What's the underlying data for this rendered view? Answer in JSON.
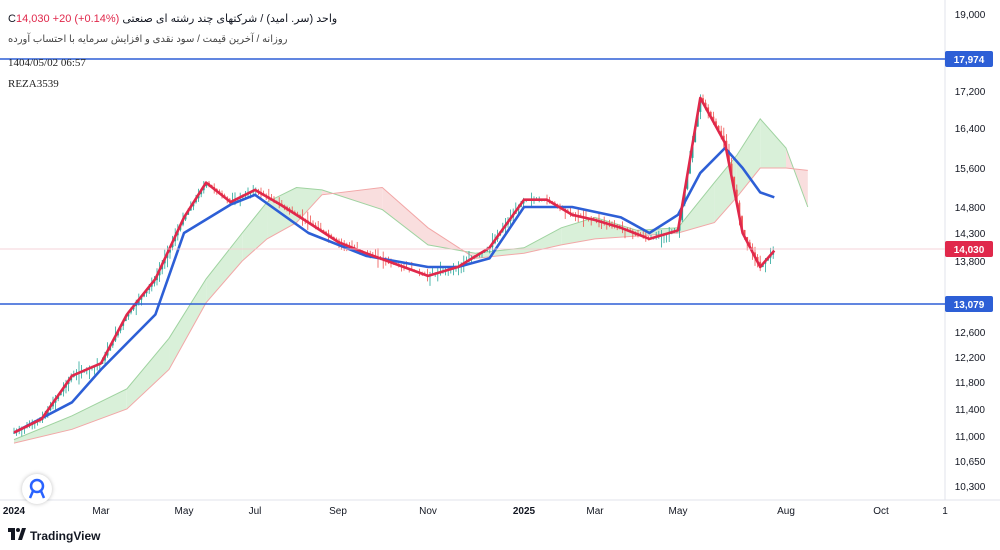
{
  "header": {
    "title": "واحد (سر. امید) / شرکتهای چند رشته ای صنعتی",
    "ohlc_prefix": "C",
    "close_label": "14,030",
    "change_label": "+20 (+0.14%)",
    "subtitle": "روزانه / آخرین قیمت / سود نقدی و افزایش سرمایه با احتساب آورده",
    "date": "1404/05/02 06:57",
    "user": "REZA3539"
  },
  "colors": {
    "price_line": "#e0284b",
    "baseline": "#2d5fd6",
    "kijun_h": "#3a66e0",
    "cloud_bull": "#d9f0d9",
    "cloud_bear": "#f9dede",
    "candle_up": "#26a69a",
    "candle_down": "#ef5350",
    "hline": "#2d5fd6",
    "price_label_bg": "#e0284b"
  },
  "icons": {
    "logo": "tradingview-logo-icon",
    "badge": "ideas-icon"
  },
  "brand": "TradingView",
  "chart_data": {
    "type": "line",
    "y_ticks": [
      "19,000",
      "17,200",
      "16,400",
      "15,600",
      "14,800",
      "14,300",
      "13,800",
      "12,600",
      "12,200",
      "11,800",
      "11,400",
      "11,000",
      "10,650",
      "10,300"
    ],
    "x_ticks": [
      "2024",
      "Mar",
      "May",
      "Jul",
      "Sep",
      "Nov",
      "2025",
      "Mar",
      "May",
      "Aug",
      "Oct",
      "1"
    ],
    "horizontal_lines": [
      {
        "label": "17,974",
        "value": 17974
      },
      {
        "label": "13,079",
        "value": 13079
      }
    ],
    "last_price_label": "14,030",
    "last_price": 14030,
    "ylim": [
      10300,
      19000
    ],
    "series": [
      {
        "role": "close",
        "x": [
          "2024-01-01",
          "2024-01-20",
          "2024-02-10",
          "2024-03-01",
          "2024-03-20",
          "2024-04-10",
          "2024-05-01",
          "2024-05-20",
          "2024-06-10",
          "2024-07-01",
          "2024-07-20",
          "2024-08-10",
          "2024-09-01",
          "2024-09-20",
          "2024-10-10",
          "2024-11-01",
          "2024-11-20",
          "2024-12-10",
          "2025-01-01",
          "2025-01-20",
          "2025-02-10",
          "2025-03-01",
          "2025-03-20",
          "2025-04-10",
          "2025-05-01",
          "2025-05-20",
          "2025-06-10",
          "2025-06-25",
          "2025-07-10",
          "2025-07-22"
        ],
        "y": [
          11050,
          11250,
          11900,
          12100,
          12900,
          13500,
          14600,
          15300,
          14900,
          15150,
          14850,
          14500,
          14150,
          13950,
          13750,
          13550,
          13700,
          14050,
          14950,
          14950,
          14650,
          14550,
          14400,
          14200,
          14350,
          17050,
          16100,
          14300,
          13700,
          14000
        ]
      },
      {
        "role": "baseline",
        "x": [
          "2024-01-01",
          "2024-02-10",
          "2024-03-01",
          "2024-04-10",
          "2024-05-01",
          "2024-06-10",
          "2024-07-01",
          "2024-08-10",
          "2024-09-20",
          "2024-11-01",
          "2024-11-20",
          "2024-12-10",
          "2025-01-01",
          "2025-02-10",
          "2025-03-20",
          "2025-04-10",
          "2025-05-01",
          "2025-05-20",
          "2025-06-10",
          "2025-06-25",
          "2025-07-10",
          "2025-07-22"
        ],
        "y": [
          11050,
          11500,
          12000,
          12900,
          14300,
          14850,
          15050,
          14300,
          13900,
          13700,
          13700,
          13850,
          14800,
          14800,
          14600,
          14300,
          14650,
          15500,
          16000,
          15600,
          15100,
          15000
        ]
      },
      {
        "role": "cloud_a",
        "x": [
          "2024-01-01",
          "2024-02-10",
          "2024-03-20",
          "2024-04-20",
          "2024-05-20",
          "2024-06-20",
          "2024-07-10",
          "2024-08-01",
          "2024-08-20",
          "2024-10-01",
          "2024-11-01",
          "2024-12-01",
          "2025-01-01",
          "2025-02-01",
          "2025-03-01",
          "2025-04-01",
          "2025-05-01",
          "2025-06-01",
          "2025-06-20",
          "2025-07-10",
          "2025-08-01",
          "2025-08-15"
        ],
        "y": [
          10950,
          11300,
          11700,
          12500,
          13500,
          14300,
          14900,
          15200,
          15150,
          14750,
          14100,
          13950,
          14050,
          14400,
          14600,
          14350,
          14400,
          15300,
          15850,
          16600,
          16000,
          14800
        ]
      },
      {
        "role": "cloud_b",
        "x": [
          "2024-01-01",
          "2024-02-10",
          "2024-03-20",
          "2024-04-20",
          "2024-05-20",
          "2024-06-20",
          "2024-07-10",
          "2024-08-01",
          "2024-08-20",
          "2024-10-01",
          "2024-11-01",
          "2024-12-01",
          "2025-01-01",
          "2025-02-01",
          "2025-03-01",
          "2025-04-01",
          "2025-05-01",
          "2025-06-01",
          "2025-06-20",
          "2025-07-10",
          "2025-08-01",
          "2025-08-15"
        ],
        "y": [
          10900,
          11100,
          11400,
          12000,
          13100,
          13800,
          14200,
          14500,
          15050,
          15200,
          14400,
          13850,
          13950,
          14100,
          14200,
          14250,
          14300,
          14500,
          15000,
          15600,
          15600,
          15550
        ]
      }
    ]
  }
}
